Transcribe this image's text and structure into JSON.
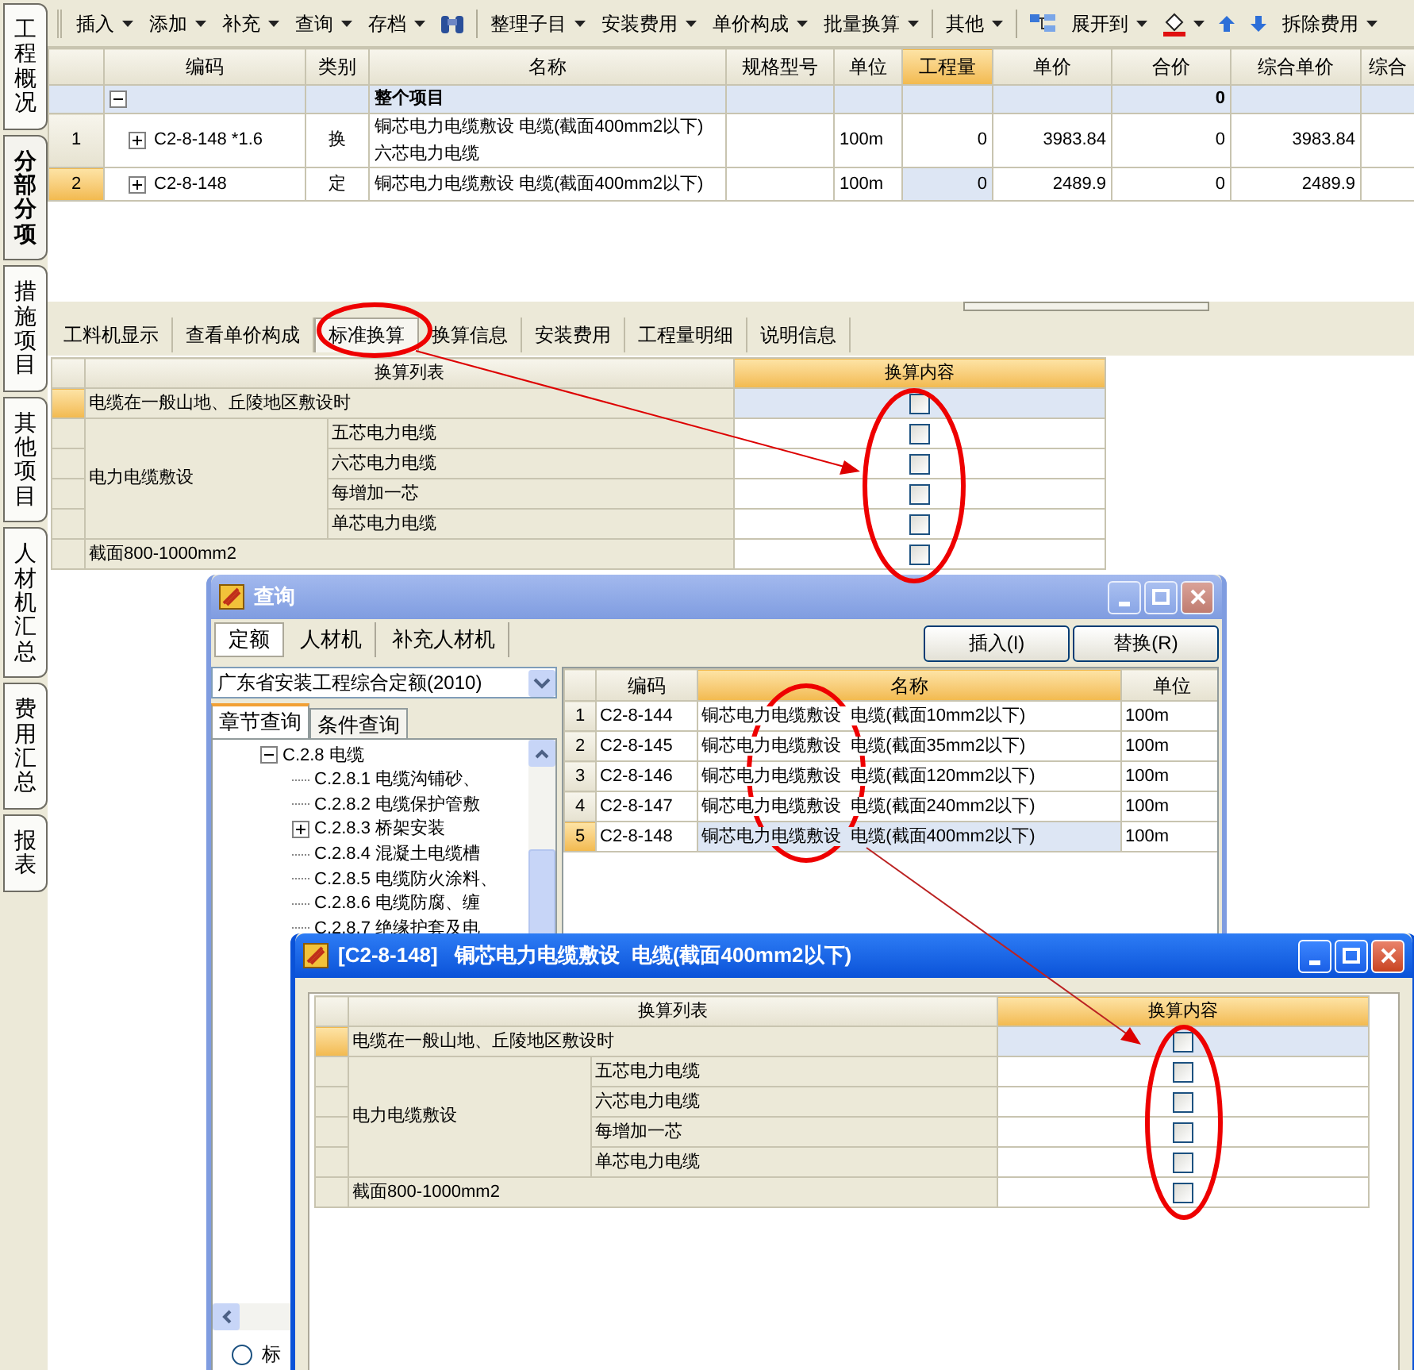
{
  "side_tabs": [
    {
      "label": "工程概况",
      "selected": false
    },
    {
      "label": "分部分项",
      "selected": true
    },
    {
      "label": "措施项目",
      "selected": false
    },
    {
      "label": "其他项目",
      "selected": false
    },
    {
      "label": "人材机汇总",
      "selected": false
    },
    {
      "label": "费用汇总",
      "selected": false
    },
    {
      "label": "报表",
      "selected": false
    }
  ],
  "toolbar": [
    {
      "kind": "menu",
      "label": "插入",
      "dropdown": true
    },
    {
      "kind": "menu",
      "label": "添加",
      "dropdown": true
    },
    {
      "kind": "menu",
      "label": "补充",
      "dropdown": true
    },
    {
      "kind": "menu",
      "label": "查询",
      "dropdown": true
    },
    {
      "kind": "menu",
      "label": "存档",
      "dropdown": true
    },
    {
      "kind": "tool",
      "dropdown": false
    },
    {
      "kind": "separator"
    },
    {
      "kind": "menu",
      "label": "整理子目",
      "dropdown": true
    },
    {
      "kind": "menu",
      "label": "安装费用",
      "dropdown": true
    },
    {
      "kind": "menu",
      "label": "单价构成",
      "dropdown": true
    },
    {
      "kind": "menu",
      "label": "批量换算",
      "dropdown": true
    },
    {
      "kind": "separator"
    },
    {
      "kind": "menu",
      "label": "其他",
      "dropdown": true
    },
    {
      "kind": "separator"
    },
    {
      "kind": "tool",
      "dropdown": false
    },
    {
      "kind": "menu",
      "label": "展开到",
      "dropdown": true
    },
    {
      "kind": "tool",
      "dropdown": true
    },
    {
      "kind": "tool",
      "dropdown": false
    },
    {
      "kind": "tool",
      "dropdown": false
    },
    {
      "kind": "menu",
      "label": "拆除费用",
      "dropdown": true
    }
  ],
  "items_table": {
    "columns": [
      {
        "label": "编码",
        "selected": false
      },
      {
        "label": "类别",
        "selected": false
      },
      {
        "label": "名称",
        "selected": false
      },
      {
        "label": "规格型号",
        "selected": false
      },
      {
        "label": "单位",
        "selected": false
      },
      {
        "label": "工程量",
        "selected": true
      },
      {
        "label": "单价",
        "selected": false
      },
      {
        "label": "合价",
        "selected": false
      },
      {
        "label": "综合单价",
        "selected": false
      },
      {
        "label": "综合",
        "selected": false
      }
    ],
    "rows": [
      {
        "kind": "group",
        "expanded": true,
        "selected": false,
        "name": "整个项目",
        "total": "0"
      },
      {
        "kind": "item",
        "expanded": false,
        "selected": false,
        "number": "1",
        "code": "C2-8-148 *1.6",
        "type": "换",
        "name": "铜芯电力电缆敷设  电缆(截面400mm2以下)\n 六芯电力电缆",
        "unit": "100m",
        "quantity": "0",
        "unit_price": "3983.84",
        "total": "0",
        "composite_price": "3983.84"
      },
      {
        "kind": "item",
        "expanded": false,
        "selected": true,
        "number": "2",
        "code": "C2-8-148",
        "type": "定",
        "name": "铜芯电力电缆敷设  电缆(截面400mm2以下)",
        "unit": "100m",
        "quantity": "0",
        "unit_price": "2489.9",
        "total": "0",
        "composite_price": "2489.9"
      }
    ]
  },
  "detail_tabs": [
    {
      "label": "工料机显示",
      "selected": false
    },
    {
      "label": "查看单价构成",
      "selected": false
    },
    {
      "label": "标准换算",
      "selected": true
    },
    {
      "label": "换算信息",
      "selected": false
    },
    {
      "label": "安装费用",
      "selected": false
    },
    {
      "label": "工程量明细",
      "selected": false
    },
    {
      "label": "说明信息",
      "selected": false
    }
  ],
  "conversions": {
    "columns": [
      {
        "label": "换算列表",
        "selected": false
      },
      {
        "label": "换算内容",
        "selected": true
      }
    ],
    "rows": [
      {
        "label": "电缆在一般山地、丘陵地区敷设时",
        "checked": false,
        "selected": true
      },
      {
        "label": "电力电缆敷设",
        "children": [
          {
            "label": "五芯电力电缆",
            "checked": false,
            "selected": false
          },
          {
            "label": "六芯电力电缆",
            "checked": false,
            "selected": false
          },
          {
            "label": "每增加一芯",
            "checked": false,
            "selected": false
          },
          {
            "label": "单芯电力电缆",
            "checked": false,
            "selected": false
          }
        ]
      },
      {
        "label": "截面800-1000mm2",
        "checked": false,
        "selected": false
      }
    ]
  },
  "query_window": {
    "title": "查询",
    "active": false,
    "tabs": [
      {
        "label": "定额",
        "selected": true
      },
      {
        "label": "人材机",
        "selected": false
      },
      {
        "label": "补充人材机",
        "selected": false
      }
    ],
    "buttons": [
      "插入(I)",
      "替换(R)"
    ],
    "library": "广东省安装工程综合定额(2010)",
    "sub_tabs": [
      {
        "label": "章节查询",
        "selected": true
      },
      {
        "label": "条件查询",
        "selected": false
      }
    ],
    "tree": [
      {
        "label": "C.2.8 电缆",
        "expanded": true,
        "children": [
          {
            "label": "C.2.8.1 电缆沟铺砂、"
          },
          {
            "label": "C.2.8.2 电缆保护管敷"
          },
          {
            "label": "C.2.8.3 桥架安装",
            "expanded": false
          },
          {
            "label": "C.2.8.4 混凝土电缆槽"
          },
          {
            "label": "C.2.8.5 电缆防火涂料、"
          },
          {
            "label": "C.2.8.6 电缆防腐、缠"
          },
          {
            "label": "C.2.8.7 绝缘护套及电"
          }
        ]
      }
    ],
    "radio": {
      "label": "标",
      "selected": false
    },
    "results": {
      "columns": [
        {
          "label": "编码",
          "selected": false
        },
        {
          "label": "名称",
          "selected": true
        },
        {
          "label": "单位",
          "selected": false
        }
      ],
      "rows": [
        {
          "number": "1",
          "code": "C2-8-144",
          "name": "铜芯电力电缆敷设  电缆(截面10mm2以下)",
          "unit": "100m",
          "selected": false
        },
        {
          "number": "2",
          "code": "C2-8-145",
          "name": "铜芯电力电缆敷设  电缆(截面35mm2以下)",
          "unit": "100m",
          "selected": false
        },
        {
          "number": "3",
          "code": "C2-8-146",
          "name": "铜芯电力电缆敷设  电缆(截面120mm2以下)",
          "unit": "100m",
          "selected": false
        },
        {
          "number": "4",
          "code": "C2-8-147",
          "name": "铜芯电力电缆敷设  电缆(截面240mm2以下)",
          "unit": "100m",
          "selected": false
        },
        {
          "number": "5",
          "code": "C2-8-148",
          "name": "铜芯电力电缆敷设  电缆(截面400mm2以下)",
          "unit": "100m",
          "selected": true
        }
      ]
    }
  },
  "conversion_dialog": {
    "title": "[C2-8-148]   铜芯电力电缆敷设  电缆(截面400mm2以下)",
    "active": true,
    "columns": [
      {
        "label": "换算列表",
        "selected": false
      },
      {
        "label": "换算内容",
        "selected": true
      }
    ],
    "rows": [
      {
        "label": "电缆在一般山地、丘陵地区敷设时",
        "checked": false,
        "selected": true
      },
      {
        "label": "电力电缆敷设",
        "children": [
          {
            "label": "五芯电力电缆",
            "checked": false,
            "selected": false
          },
          {
            "label": "六芯电力电缆",
            "checked": false,
            "selected": false
          },
          {
            "label": "每增加一芯",
            "checked": false,
            "selected": false
          },
          {
            "label": "单芯电力电缆",
            "checked": false,
            "selected": false
          }
        ]
      },
      {
        "label": "截面800-1000mm2",
        "checked": false,
        "selected": false
      }
    ]
  }
}
